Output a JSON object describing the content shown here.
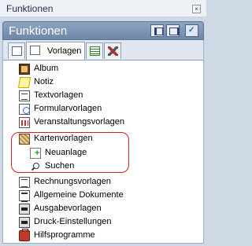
{
  "window": {
    "title": "Funktionen",
    "close_glyph": "×"
  },
  "panel": {
    "title": "Funktionen",
    "buttons": [
      {
        "name": "dock-left-icon"
      },
      {
        "name": "dock-right-icon"
      },
      {
        "name": "pin-icon",
        "glyph": "✓"
      }
    ]
  },
  "tabs": [
    {
      "name": "tab-blank",
      "label": "",
      "icon": "blank-page-icon"
    },
    {
      "name": "tab-vorlagen",
      "label": "Vorlagen",
      "icon": "document-icon",
      "selected": true
    },
    {
      "name": "tab-list",
      "label": "",
      "icon": "list-icon"
    },
    {
      "name": "tab-tools",
      "label": "",
      "icon": "tools-icon"
    }
  ],
  "items": [
    {
      "label": "Album",
      "icon": "album-icon"
    },
    {
      "label": "Notiz",
      "icon": "note-icon"
    },
    {
      "label": "Textvorlagen",
      "icon": "text-template-icon"
    },
    {
      "label": "Formularvorlagen",
      "icon": "form-template-icon"
    },
    {
      "label": "Veranstaltungsvorlagen",
      "icon": "event-template-icon"
    },
    {
      "label": "Kartenvorlagen",
      "icon": "map-template-icon"
    },
    {
      "label": "Neuanlage",
      "icon": "new-document-icon"
    },
    {
      "label": "Suchen",
      "icon": "search-icon"
    },
    {
      "label": "Rechnungsvorlagen",
      "icon": "invoice-template-icon"
    },
    {
      "label": "Allgemeine Dokumente",
      "icon": "general-document-icon"
    },
    {
      "label": "Ausgabevorlagen",
      "icon": "output-template-icon"
    },
    {
      "label": "Druck-Einstellungen",
      "icon": "printer-icon"
    },
    {
      "label": "Hilfsprogramme",
      "icon": "toolbox-icon"
    }
  ],
  "colors": {
    "panel_header": "#7890b0",
    "highlight_border": "#d62020",
    "background": "#cfd9e6"
  }
}
